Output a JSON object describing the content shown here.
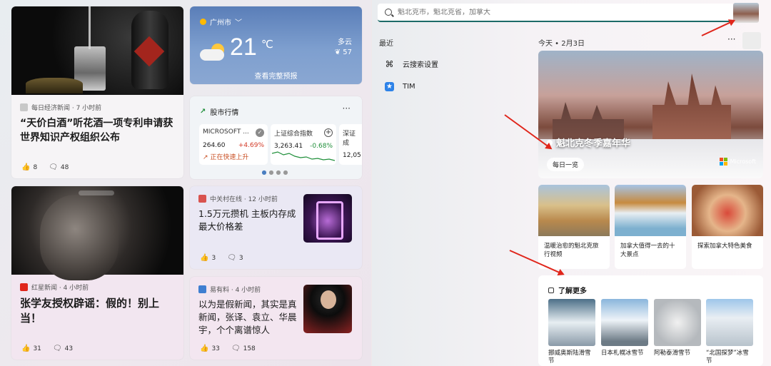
{
  "left": {
    "news1": {
      "source": "每日经济新闻 · 7 小时前",
      "title": "“天价白酒”听花酒一项专利申请获世界知识产权组织公布",
      "likes": "8",
      "comments": "48"
    },
    "weather": {
      "location": "广州市",
      "temp": "21",
      "unit": "℃",
      "condition": "多云",
      "aqi": "57",
      "aqi_icon": "leaf-icon",
      "more": "查看完整预报"
    },
    "stocks": {
      "title": "股市行情",
      "tiles": [
        {
          "name": "MICROSOFT ...",
          "price": "264.60",
          "change": "+4.69%",
          "note": "正在快速上升"
        },
        {
          "name": "上证综合指数",
          "price": "3,263.41",
          "change": "-0.68%"
        },
        {
          "name": "深证成",
          "price": "12,05"
        }
      ]
    },
    "news2": {
      "source": "红星新闻 · 4 小时前",
      "title": "张学友授权辟谣：假的！别上当！",
      "likes": "31",
      "comments": "43"
    },
    "news3": {
      "source": "中关村在线 · 12 小时前",
      "title": "1.5万元攒机 主板内存成最大价格差",
      "likes": "3",
      "comments": "3"
    },
    "news4": {
      "source": "易有料 · 4 小时前",
      "title": "以为是假新闻，其实是真新闻，张译、袁立、华晨宇，个个离谱惊人",
      "likes": "33",
      "comments": "158"
    }
  },
  "right": {
    "search": {
      "placeholder": "魁北克市，魁北克省，加拿大"
    },
    "recent_label": "最近",
    "recent_items": [
      {
        "label": "云搜索设置",
        "icon": "cloud-search-icon"
      },
      {
        "label": "TIM",
        "icon": "tim-app-icon"
      }
    ],
    "today_label": "今天 • 2月3日",
    "hero": {
      "caption": "魁北克冬季嘉年华",
      "badge": "每日一览",
      "brand": "Microsoft"
    },
    "minis": [
      {
        "caption": "温暖治愈的魁北克旅行视频"
      },
      {
        "caption": "加拿大值得一去的十大景点"
      },
      {
        "caption": "探索加拿大特色美食"
      }
    ],
    "learn_more": {
      "title": "了解更多",
      "items": [
        {
          "caption": "挪威奥斯陆滑雪节"
        },
        {
          "caption": "日本札幌冰雪节"
        },
        {
          "caption": "阿勒泰滑雪节"
        },
        {
          "caption": "“北国探梦”冰雪节"
        }
      ]
    }
  },
  "colors": {
    "arrow": "#e0261b",
    "accent": "#1c6b68",
    "positive": "#d33b28"
  }
}
